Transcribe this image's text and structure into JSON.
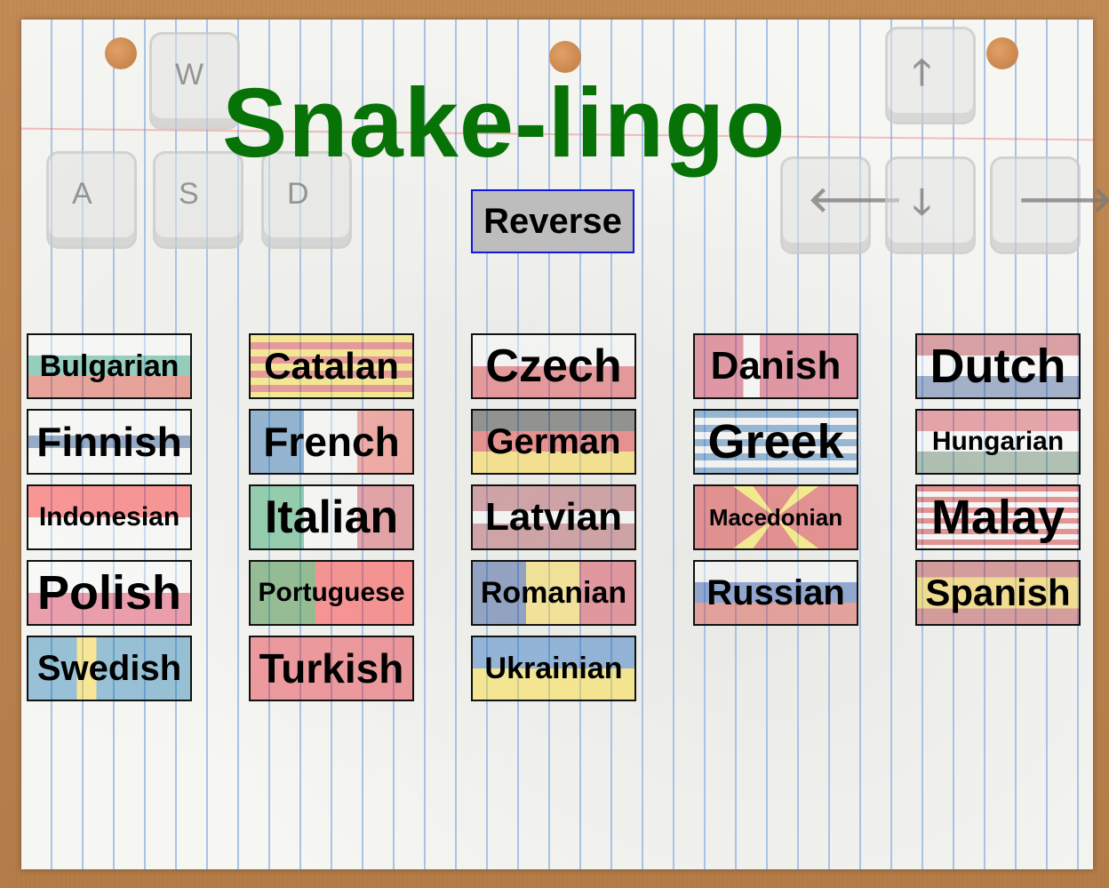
{
  "title": "Snake-lingo",
  "reverse_label": "Reverse",
  "keys": {
    "w": "W",
    "a": "A",
    "s": "S",
    "d": "D",
    "up": "🡑",
    "left": "🡐",
    "down": "🡓",
    "right": "🡒"
  },
  "languages": [
    {
      "label": "Bulgarian",
      "flag": "bulgaria-flag"
    },
    {
      "label": "Catalan",
      "flag": "catalonia-flag"
    },
    {
      "label": "Czech",
      "flag": "czech-flag"
    },
    {
      "label": "Danish",
      "flag": "denmark-flag"
    },
    {
      "label": "Dutch",
      "flag": "netherlands-flag"
    },
    {
      "label": "Finnish",
      "flag": "finland-flag"
    },
    {
      "label": "French",
      "flag": "france-flag"
    },
    {
      "label": "German",
      "flag": "germany-flag"
    },
    {
      "label": "Greek",
      "flag": "greece-flag"
    },
    {
      "label": "Hungarian",
      "flag": "hungary-flag"
    },
    {
      "label": "Indonesian",
      "flag": "indonesia-flag"
    },
    {
      "label": "Italian",
      "flag": "italy-flag"
    },
    {
      "label": "Latvian",
      "flag": "latvia-flag"
    },
    {
      "label": "Macedonian",
      "flag": "macedonia-flag"
    },
    {
      "label": "Malay",
      "flag": "malaysia-flag"
    },
    {
      "label": "Polish",
      "flag": "poland-flag"
    },
    {
      "label": "Portuguese",
      "flag": "portugal-flag"
    },
    {
      "label": "Romanian",
      "flag": "romania-flag"
    },
    {
      "label": "Russian",
      "flag": "russia-flag"
    },
    {
      "label": "Spanish",
      "flag": "spain-flag"
    },
    {
      "label": "Swedish",
      "flag": "sweden-flag"
    },
    {
      "label": "Turkish",
      "flag": "turkey-flag"
    },
    {
      "label": "Ukrainian",
      "flag": "ukraine-flag"
    }
  ],
  "colors": {
    "title": "#077307",
    "reverse_bg": "#bdbdbd",
    "reverse_border": "#1515e0"
  }
}
